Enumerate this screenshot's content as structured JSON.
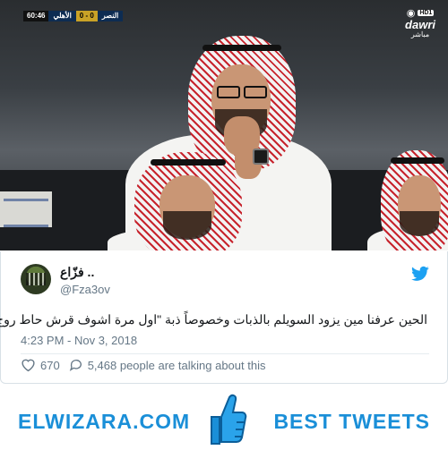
{
  "broadcast": {
    "clock": "60:46",
    "home_team": "النصر",
    "home_score": "0",
    "separator": "-",
    "away_score": "0",
    "away_team": "الأهلي",
    "channel_badge": "HD1",
    "channel_name": "dawri",
    "live_label": "مباشر"
  },
  "tweet": {
    "display_name": "فزّاع ..",
    "handle": "@Fza3ov",
    "text": "الحين عرفنا مين يزود السويلم بالذبات وخصوصاً ذبة \"اول مرة اشوف قرش حاط روج \"",
    "timestamp": "4:23 PM - Nov 3, 2018",
    "likes": "670",
    "talking": "5,468 people are talking about this"
  },
  "banner": {
    "left": "ELWIZARA.COM",
    "right": "BEST TWEETS"
  },
  "colors": {
    "twitter_blue": "#1da1f2",
    "banner_blue": "#1a8fd8",
    "muted": "#657786"
  },
  "icons": [
    "twitter-bird-icon",
    "heart-icon",
    "comment-bubble-icon",
    "thumbs-up-icon",
    "hd-eye-icon"
  ]
}
